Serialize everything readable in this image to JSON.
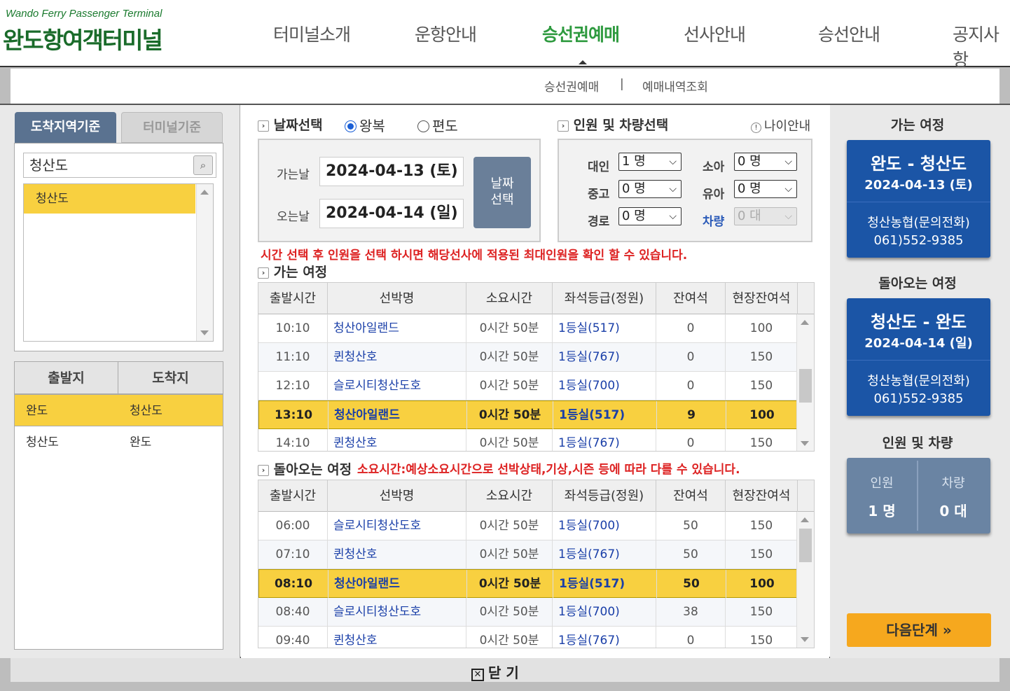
{
  "header": {
    "logo_en": "Wando Ferry Passenger Terminal",
    "logo_ko": "완도항여객터미널",
    "nav": [
      "터미널소개",
      "운항안내",
      "승선권예매",
      "선사안내",
      "승선안내",
      "공지사항"
    ],
    "active_nav": "승선권예매"
  },
  "subnav": {
    "items": [
      "승선권예매",
      "예매내역조회"
    ],
    "separator": "|"
  },
  "left": {
    "tabs": [
      "도착지역기준",
      "터미널기준"
    ],
    "search_value": "청산도",
    "search_icon": "magnifier-icon",
    "destinations": [
      "청산도"
    ],
    "route_headers": [
      "출발지",
      "도착지"
    ],
    "routes": [
      {
        "from": "완도",
        "to": "청산도",
        "selected": true
      },
      {
        "from": "청산도",
        "to": "완도",
        "selected": false
      }
    ]
  },
  "date_section": {
    "title": "날짜선택",
    "arrow": "›",
    "trip_types": [
      "왕복",
      "편도"
    ],
    "selected_trip_type": "왕복",
    "depart_label": "가는날",
    "depart_date": "2024-04-13 (토)",
    "return_label": "오는날",
    "return_date": "2024-04-14 (일)",
    "select_button": "날짜\n선택"
  },
  "pax_section": {
    "title": "인원 및 차량선택",
    "age_info": "나이안내",
    "age_info_icon": "!",
    "fields": [
      {
        "label": "대인",
        "value": "1 명"
      },
      {
        "label": "소아",
        "value": "0 명"
      },
      {
        "label": "중고",
        "value": "0 명"
      },
      {
        "label": "유아",
        "value": "0 명"
      },
      {
        "label": "경로",
        "value": "0 명"
      },
      {
        "label": "차량",
        "value": "0 대",
        "disabled": true
      }
    ]
  },
  "notice1": "시간 선택 후 인원을 선택 하시면 해당선사에 적용된 최대인원을 확인 할 수 있습니다.",
  "outbound": {
    "title": "가는 여정",
    "headers": [
      "출발시간",
      "선박명",
      "소요시간",
      "좌석등급(정원)",
      "잔여석",
      "현장잔여석"
    ],
    "rows": [
      {
        "time": "10:10",
        "ship": "청산아일랜드",
        "dur": "0시간 50분",
        "grade": "1등실(517)",
        "left": "0",
        "site": "100",
        "sel": false
      },
      {
        "time": "11:10",
        "ship": "퀸청산호",
        "dur": "0시간 50분",
        "grade": "1등실(767)",
        "left": "0",
        "site": "150",
        "sel": false
      },
      {
        "time": "12:10",
        "ship": "슬로시티청산도호",
        "dur": "0시간 50분",
        "grade": "1등실(700)",
        "left": "0",
        "site": "150",
        "sel": false
      },
      {
        "time": "13:10",
        "ship": "청산아일랜드",
        "dur": "0시간 50분",
        "grade": "1등실(517)",
        "left": "9",
        "site": "100",
        "sel": true
      },
      {
        "time": "14:10",
        "ship": "퀸청산호",
        "dur": "0시간 50분",
        "grade": "1등실(767)",
        "left": "0",
        "site": "150",
        "sel": false
      }
    ]
  },
  "inbound": {
    "title": "돌아오는 여정",
    "notice": "소요시간:예상소요시간으로 선박상태,기상,시즌 등에 따라 다를 수 있습니다.",
    "headers": [
      "출발시간",
      "선박명",
      "소요시간",
      "좌석등급(정원)",
      "잔여석",
      "현장잔여석"
    ],
    "rows": [
      {
        "time": "06:00",
        "ship": "슬로시티청산도호",
        "dur": "0시간 50분",
        "grade": "1등실(700)",
        "left": "50",
        "site": "150",
        "sel": false
      },
      {
        "time": "07:10",
        "ship": "퀸청산호",
        "dur": "0시간 50분",
        "grade": "1등실(767)",
        "left": "50",
        "site": "150",
        "sel": false
      },
      {
        "time": "08:10",
        "ship": "청산아일랜드",
        "dur": "0시간 50분",
        "grade": "1등실(517)",
        "left": "50",
        "site": "100",
        "sel": true
      },
      {
        "time": "08:40",
        "ship": "슬로시티청산도호",
        "dur": "0시간 50분",
        "grade": "1등실(700)",
        "left": "38",
        "site": "150",
        "sel": false
      },
      {
        "time": "09:40",
        "ship": "퀸청산호",
        "dur": "0시간 50분",
        "grade": "1등실(767)",
        "left": "0",
        "site": "150",
        "sel": false
      }
    ]
  },
  "right": {
    "outbound_title": "가는 여정",
    "outbound_route": "완도 - 청산도",
    "outbound_date": "2024-04-13 (토)",
    "outbound_company": "청산농협(문의전화)",
    "outbound_tel": "061)552-9385",
    "inbound_title": "돌아오는 여정",
    "inbound_route": "청산도 - 완도",
    "inbound_date": "2024-04-14 (일)",
    "inbound_company": "청산농협(문의전화)",
    "inbound_tel": "061)552-9385",
    "pax_title": "인원 및 차량",
    "pax_label": "인원",
    "pax_value": "1 명",
    "car_label": "차량",
    "car_value": "0 대",
    "next_button": "다음단계 »"
  },
  "footer": {
    "close_label": "닫 기",
    "close_icon": "✕"
  },
  "colors": {
    "selected_row": "#f8d040",
    "card_blue": "#1b55a6",
    "notice_red": "#dd2222",
    "active_nav": "#2e9a3f"
  }
}
